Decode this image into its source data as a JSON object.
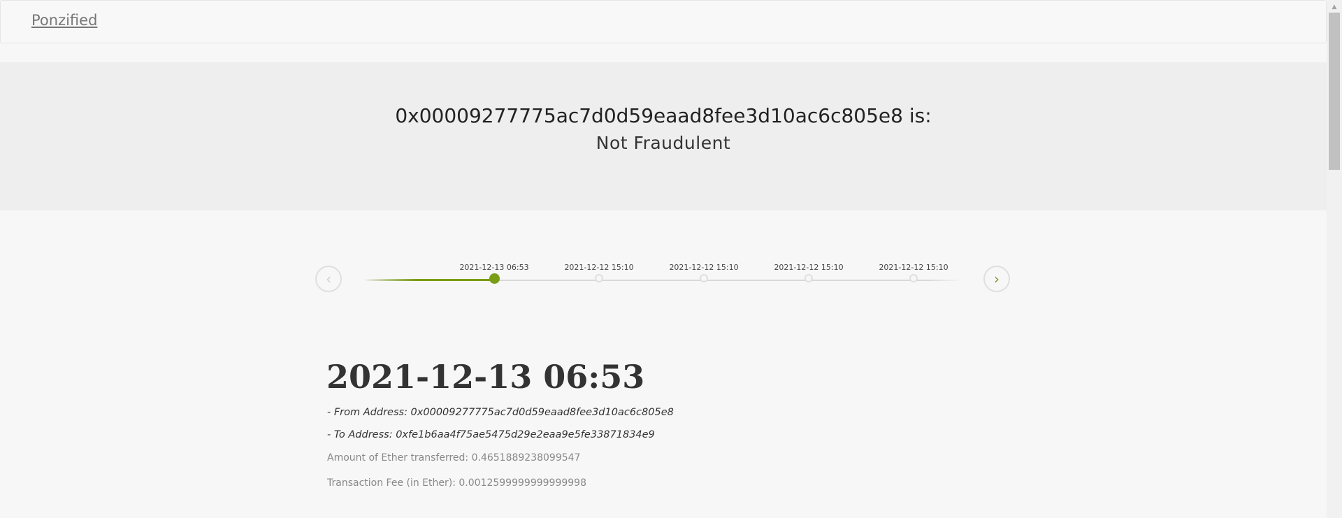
{
  "navbar": {
    "brand": "Ponzified"
  },
  "hero": {
    "address_line": "0x00009277775ac7d0d59eaad8fee3d10ac6c805e8 is:",
    "verdict": "Not Fraudulent"
  },
  "timeline": {
    "events": [
      {
        "date": "2021-12-13 06:53",
        "selected": true
      },
      {
        "date": "2021-12-12 15:10",
        "selected": false
      },
      {
        "date": "2021-12-12 15:10",
        "selected": false
      },
      {
        "date": "2021-12-12 15:10",
        "selected": false
      },
      {
        "date": "2021-12-12 15:10",
        "selected": false
      }
    ],
    "prev_icon": "chevron-left-icon",
    "next_icon": "chevron-right-icon",
    "accent_color": "#7a9d17"
  },
  "detail": {
    "title": "2021-12-13 06:53",
    "from_line": "- From Address: 0x00009277775ac7d0d59eaad8fee3d10ac6c805e8",
    "to_line": "- To Address: 0xfe1b6aa4f75ae5475d29e2eaa9e5fe33871834e9",
    "amount_line": "Amount of Ether transferred: 0.4651889238099547",
    "fee_line": "Transaction Fee (in Ether): 0.0012599999999999998"
  }
}
